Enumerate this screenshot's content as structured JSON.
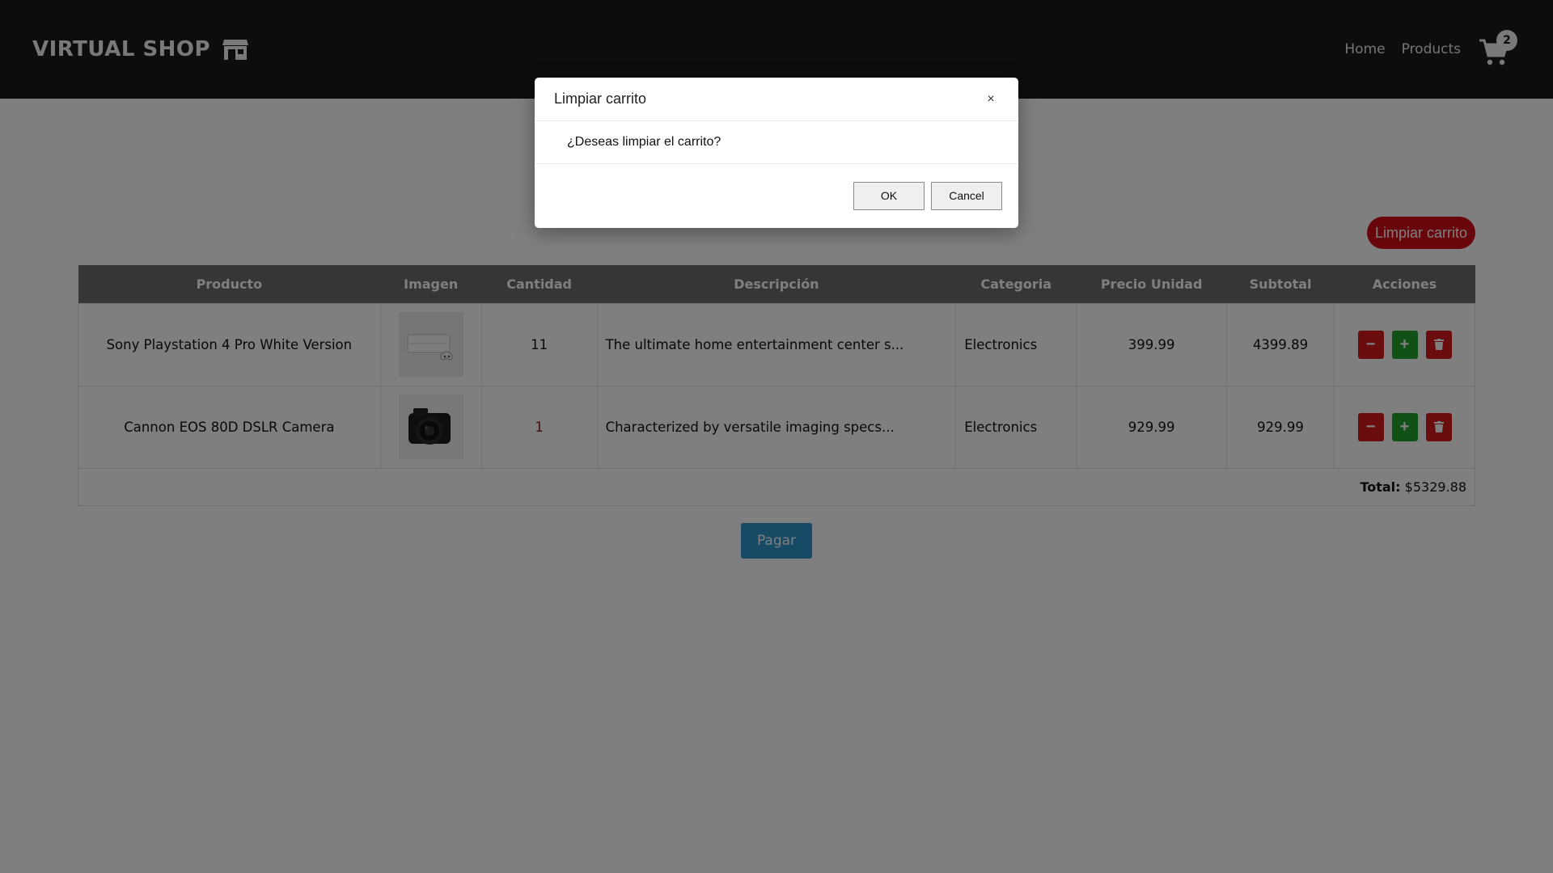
{
  "navbar": {
    "brand": "VIRTUAL SHOP",
    "brand_icon": "store-icon",
    "links": [
      "Home",
      "Products"
    ],
    "cart_icon": "cart-icon",
    "cart_count": "2"
  },
  "actions": {
    "clear_cart_label": "Limpiar carrito",
    "pay_label": "Pagar"
  },
  "table": {
    "headers": [
      "Producto",
      "Imagen",
      "Cantidad",
      "Descripción",
      "Categoria",
      "Precio Unidad",
      "Subtotal",
      "Acciones"
    ],
    "rows": [
      {
        "product": "Sony Playstation 4 Pro White Version",
        "image_icon": "ps4-image",
        "quantity": "11",
        "description": "The ultimate home entertainment center s...",
        "category": "Electronics",
        "unit_price": "399.99",
        "subtotal": "4399.89"
      },
      {
        "product": "Cannon EOS 80D DSLR Camera",
        "image_icon": "camera-image",
        "quantity": "1",
        "description": "Characterized by versatile imaging specs...",
        "category": "Electronics",
        "unit_price": "929.99",
        "subtotal": "929.99"
      }
    ],
    "total_label": "Total:",
    "total_value": "$5329.88"
  },
  "modal": {
    "title": "Limpiar carrito",
    "close_symbol": "×",
    "message": "¿Deseas limpiar el carrito?",
    "ok_label": "OK",
    "cancel_label": "Cancel"
  },
  "colors": {
    "navbar_bg": "#1a1a1a",
    "danger": "#d10d16",
    "success": "#22a02e",
    "primary": "#2f94c9",
    "header_bg": "#6d6d6d"
  }
}
